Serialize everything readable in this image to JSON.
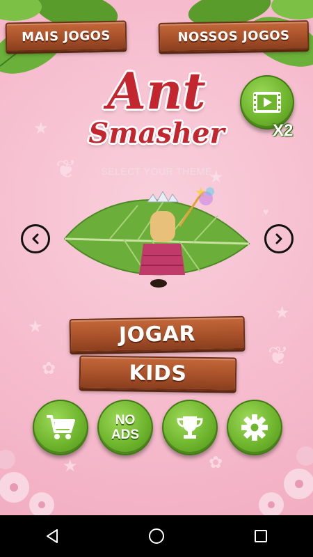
{
  "header": {
    "more_games_label": "MAIS JOGOS",
    "our_games_label": "NOSSOS JOGOS"
  },
  "logo": {
    "line1": "Ant",
    "line2": "Smasher"
  },
  "video_reward": {
    "multiplier_label": "X2"
  },
  "theme_selector": {
    "prompt": "SELECT YOUR THEME"
  },
  "menu": {
    "play_label": "JOGAR",
    "kids_label": "KIDS"
  },
  "bottom_buttons": {
    "no_ads_label": "NO\nADS"
  },
  "colors": {
    "background": "#f5b8cb",
    "wood": "#a8512a",
    "green_button": "#6fb52d",
    "logo_red": "#c3262e"
  },
  "icons": [
    "back-triangle-icon",
    "home-circle-icon",
    "recents-square-icon",
    "cart-icon",
    "trophy-icon",
    "gear-icon",
    "video-film-icon",
    "chevron-left-icon",
    "chevron-right-icon"
  ]
}
